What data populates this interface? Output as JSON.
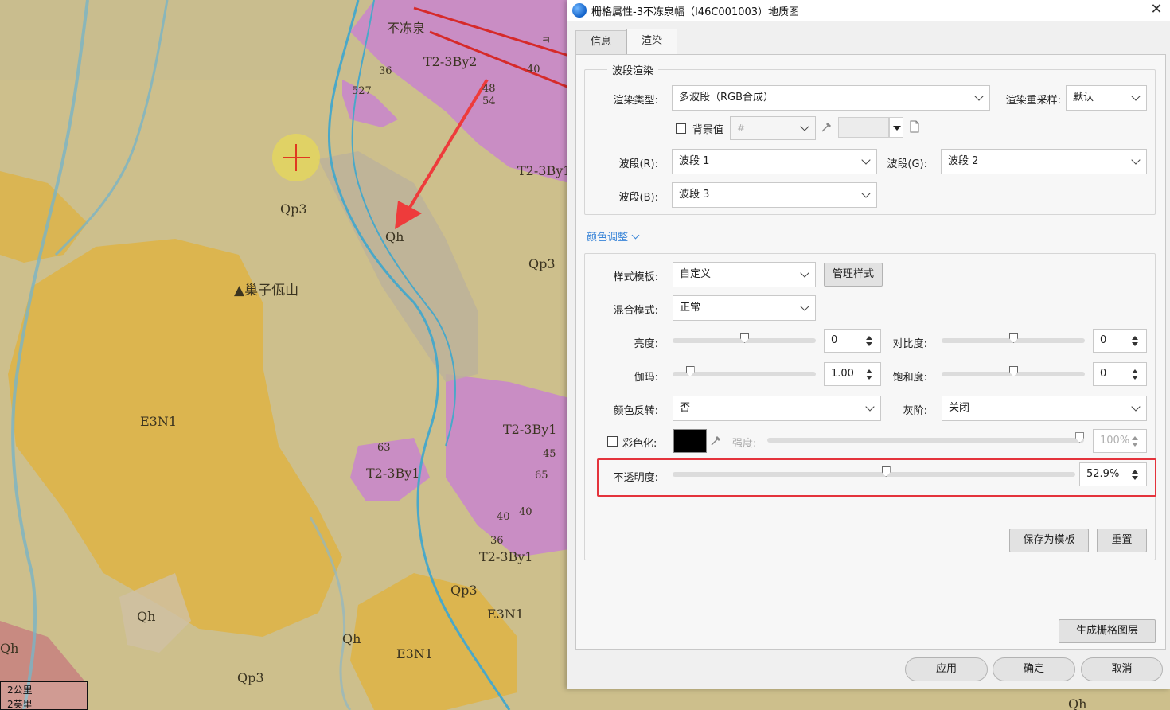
{
  "map": {
    "place_name": "▲巢子佤山",
    "labels": [
      "不冻泉",
      "T2-3By2",
      "T2-3By1",
      "T2-3By1",
      "T2-3By1",
      "T2-3By1",
      "Qp3",
      "Qp3",
      "Qp3",
      "Qp3",
      "Qh",
      "Qh",
      "Qh",
      "Qh",
      "Qh",
      "Qh",
      "E3N1",
      "E3N1",
      "E3N1",
      "36",
      "527",
      "48",
      "54",
      "63",
      "45",
      "65",
      "40",
      "40",
      "36",
      "40",
      "ㅋ"
    ],
    "scale": {
      "km": "2公里",
      "mi": "2英里"
    }
  },
  "dialog": {
    "title": "栅格属性-3不冻泉幅（I46C001003）地质图",
    "tabs": [
      {
        "label": "信息",
        "active": false
      },
      {
        "label": "渲染",
        "active": true
      }
    ],
    "band_render": {
      "group_title": "波段渲染",
      "render_type_label": "渲染类型:",
      "render_type_value": "多波段（RGB合成）",
      "resample_label": "渲染重采样:",
      "resample_value": "默认",
      "background_label": "背景值",
      "background_placeholder": "#",
      "background_checked": false,
      "band_r_label": "波段(R):",
      "band_r_value": "波段 1",
      "band_g_label": "波段(G):",
      "band_g_value": "波段 2",
      "band_b_label": "波段(B):",
      "band_b_value": "波段 3"
    },
    "color_adjust_link": "颜色调整",
    "color_adjust": {
      "style_template_label": "样式模板:",
      "style_template_value": "自定义",
      "manage_style_button": "管理样式",
      "blend_mode_label": "混合模式:",
      "blend_mode_value": "正常",
      "brightness_label": "亮度:",
      "brightness_value": "0",
      "brightness_level": 0.5,
      "contrast_label": "对比度:",
      "contrast_value": "0",
      "contrast_level": 0.5,
      "gamma_label": "伽玛:",
      "gamma_value": "1.00",
      "gamma_level": 0.12,
      "saturation_label": "饱和度:",
      "saturation_value": "0",
      "saturation_level": 0.5,
      "invert_label": "颜色反转:",
      "invert_value": "否",
      "grayscale_label": "灰阶:",
      "grayscale_value": "关闭",
      "colorize_label": "彩色化:",
      "colorize_checked": false,
      "colorize_color": "#000000",
      "strength_label": "强度:",
      "strength_value": "100%",
      "strength_level": 1.0,
      "opacity_label": "不透明度:",
      "opacity_value": "52.9%",
      "opacity_level": 0.529,
      "save_template_button": "保存为模板",
      "reset_button": "重置"
    },
    "generate_button": "生成栅格图层",
    "apply_button": "应用",
    "ok_button": "确定",
    "cancel_button": "取消"
  },
  "colors": {
    "map_base": "#cdbf8c",
    "map_yellow": "#dfb64a",
    "map_pink": "#c98dc4",
    "map_blue": "#4aa8c8",
    "highlight": "#e4333c",
    "link": "#3b86d8",
    "arrow": "#ee3b3b"
  }
}
